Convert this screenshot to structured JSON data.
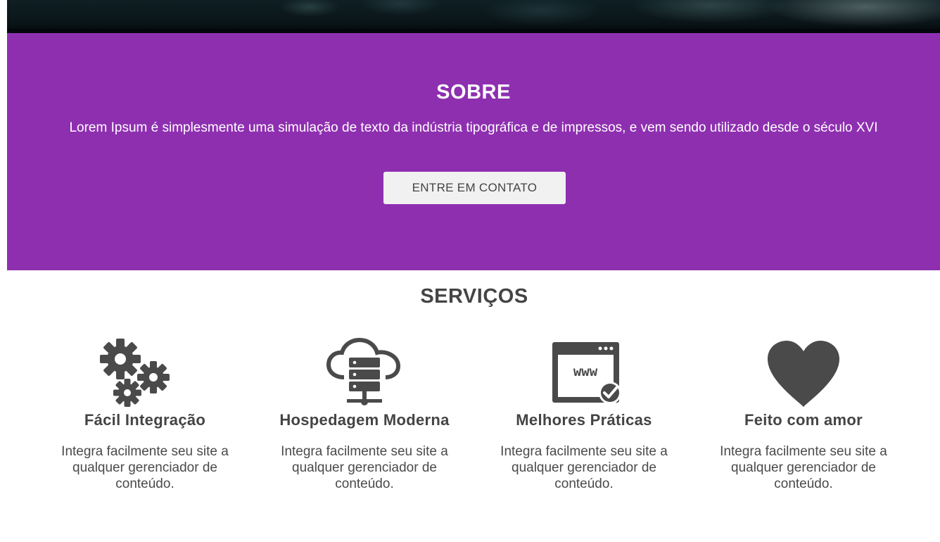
{
  "about": {
    "title": "SOBRE",
    "text": "Lorem Ipsum é simplesmente uma simulação de texto da indústria tipográfica e de impressos, e vem sendo utilizado desde o século XVI",
    "button_label": "ENTRE EM CONTATO",
    "background_color": "#8e2fb0"
  },
  "services": {
    "title": "SERVIÇOS",
    "items": [
      {
        "icon": "gears-icon",
        "title": "Fácil Integração",
        "description": "Integra facilmente seu site a qualquer gerenciador de conteúdo."
      },
      {
        "icon": "cloud-server-icon",
        "title": "Hospedagem Moderna",
        "description": "Integra facilmente seu site a qualquer gerenciador de conteúdo."
      },
      {
        "icon": "www-browser-check-icon",
        "title": "Melhores Práticas",
        "description": "Integra facilmente seu site a qualquer gerenciador de conteúdo."
      },
      {
        "icon": "heart-icon",
        "title": "Feito com amor",
        "description": "Integra facilmente seu site a qualquer gerenciador de conteúdo."
      }
    ]
  }
}
